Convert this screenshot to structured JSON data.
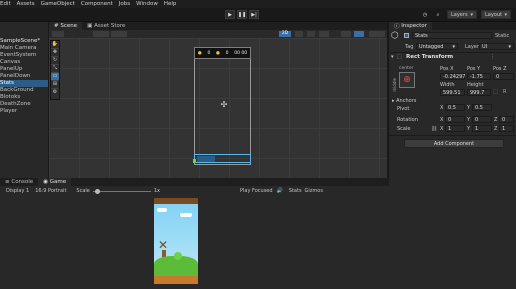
{
  "menu": [
    "Edit",
    "Assets",
    "GameObject",
    "Component",
    "Jobs",
    "Window",
    "Help"
  ],
  "toolbar": {
    "layers": "Layers",
    "layout": "Layout"
  },
  "hierarchy": {
    "scene_name": "SampleScene*",
    "items": [
      {
        "label": "Main Camera",
        "selected": false
      },
      {
        "label": "EventSystem",
        "selected": false
      },
      {
        "label": "Canvas",
        "selected": false
      },
      {
        "label": "PanelUp",
        "selected": false
      },
      {
        "label": "PanelDown",
        "selected": false
      },
      {
        "label": "Stats",
        "selected": true
      },
      {
        "label": "BackGround",
        "selected": false
      },
      {
        "label": "Blotoks",
        "selected": false
      },
      {
        "label": "DeathZone",
        "selected": false
      },
      {
        "label": "Player",
        "selected": false
      }
    ]
  },
  "scene_tabs": {
    "scene": "Scene",
    "asset_store": "Asset Store"
  },
  "scene_toolbar": {
    "mode_2d": "2D"
  },
  "scene_hud": {
    "score": "0",
    "coins": "0",
    "max": "00 00"
  },
  "inspector": {
    "tab": "Inspector",
    "object_name": "Stats",
    "static_label": "Static",
    "tag_label": "Tag",
    "tag_value": "Untagged",
    "layer_label": "Layer",
    "layer_value": "UI",
    "component": "Rect Transform",
    "anchor_preset_h": "center",
    "anchor_preset_v": "middle",
    "pos_x_label": "Pos X",
    "pos_y_label": "Pos Y",
    "pos_z_label": "Pos Z",
    "pos_x": "-0.24297",
    "pos_y": "-1.75",
    "pos_z": "0",
    "width_label": "Width",
    "height_label": "Height",
    "width": "599.51",
    "height": "999.7",
    "anchors": "Anchors",
    "pivot_label": "Pivot",
    "pivot_x": "0.5",
    "pivot_y": "0.5",
    "rotation_label": "Rotation",
    "rot_x": "0",
    "rot_y": "0",
    "rot_z": "0",
    "scale_label": "Scale",
    "scale_x": "1",
    "scale_y": "1",
    "scale_z": "1",
    "add_component": "Add Component",
    "axis_x": "X",
    "axis_y": "Y",
    "axis_z": "Z"
  },
  "bottom_tabs": {
    "console": "Console",
    "game": "Game"
  },
  "game_bar": {
    "display": "Display 1",
    "aspect": "16:9 Portrait",
    "scale_label": "Scale",
    "scale_value": "1x",
    "play_focused": "Play Focused",
    "stats": "Stats",
    "gizmos": "Gizmos"
  },
  "colors": {
    "accent": "#2c5d87",
    "sky": "#7fd0f4",
    "grass": "#5dbb3a"
  }
}
